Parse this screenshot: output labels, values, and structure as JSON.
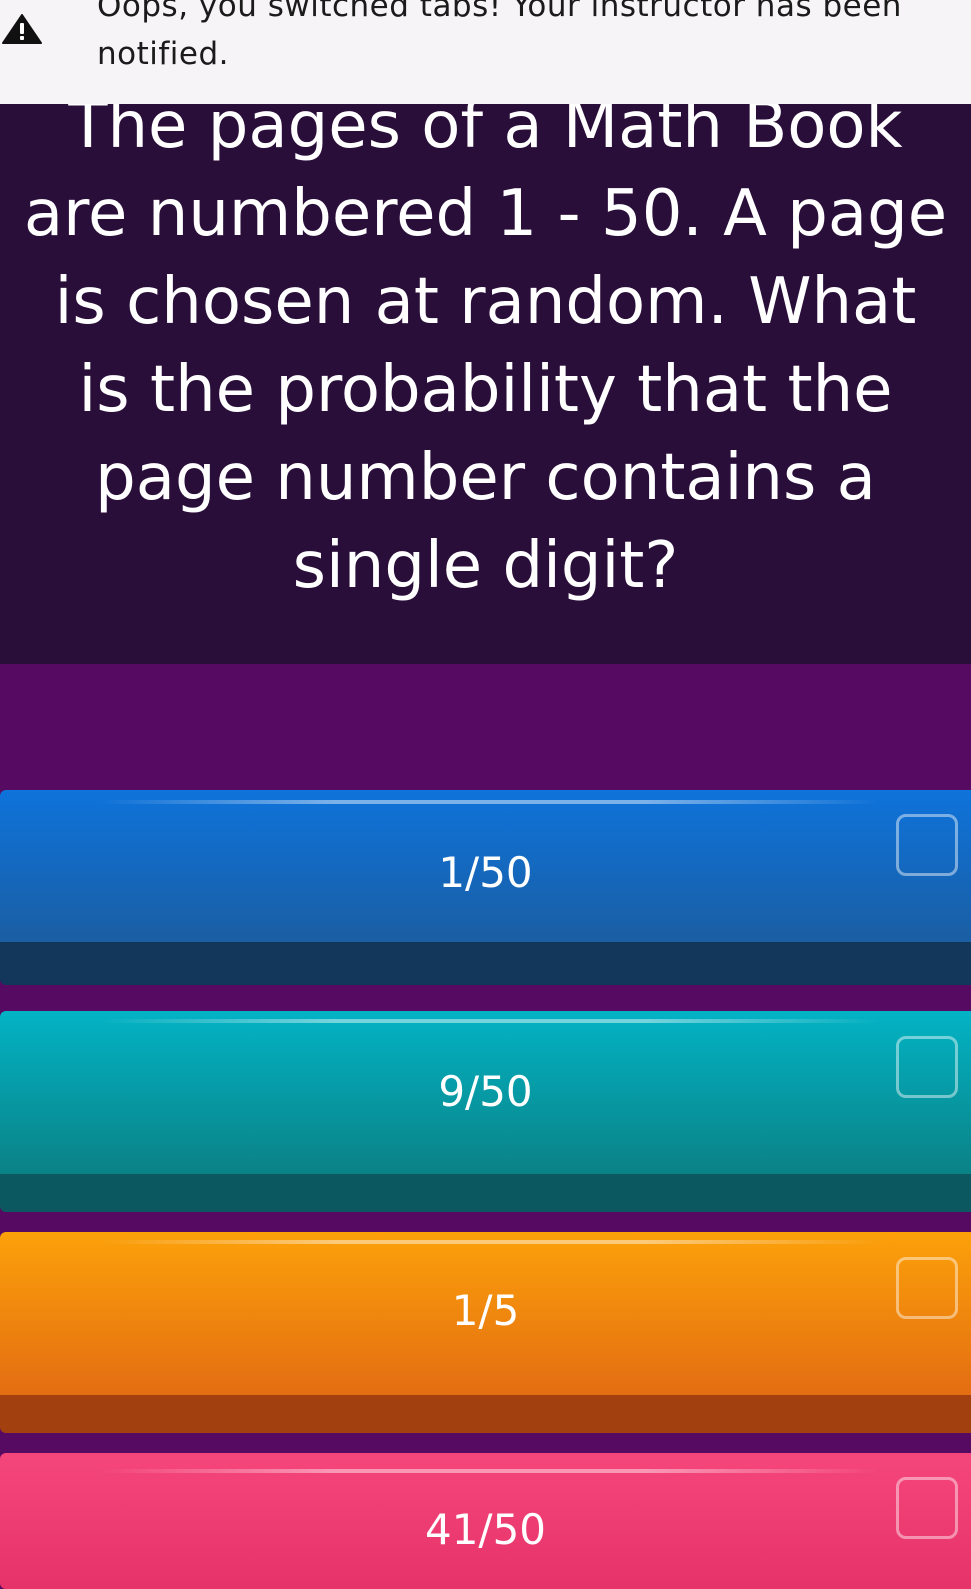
{
  "banner": {
    "icon": "warning-triangle-icon",
    "message": "Oops, you switched tabs! Your instructor has been notified."
  },
  "question": {
    "text": "The pages of a Math Book are numbered 1 - 50. A page is chosen at random. What is the probability that the page number contains a single digit?"
  },
  "options": [
    {
      "label": "1/50",
      "color": "#0e73db"
    },
    {
      "label": "9/50",
      "color": "#03b3c5"
    },
    {
      "label": "1/5",
      "color": "#fca10a"
    },
    {
      "label": "41/50",
      "color": "#f5467b"
    }
  ],
  "colors": {
    "background": "#570a62",
    "question_background": "#2a0e3a",
    "banner_background": "#f6f4f6"
  }
}
